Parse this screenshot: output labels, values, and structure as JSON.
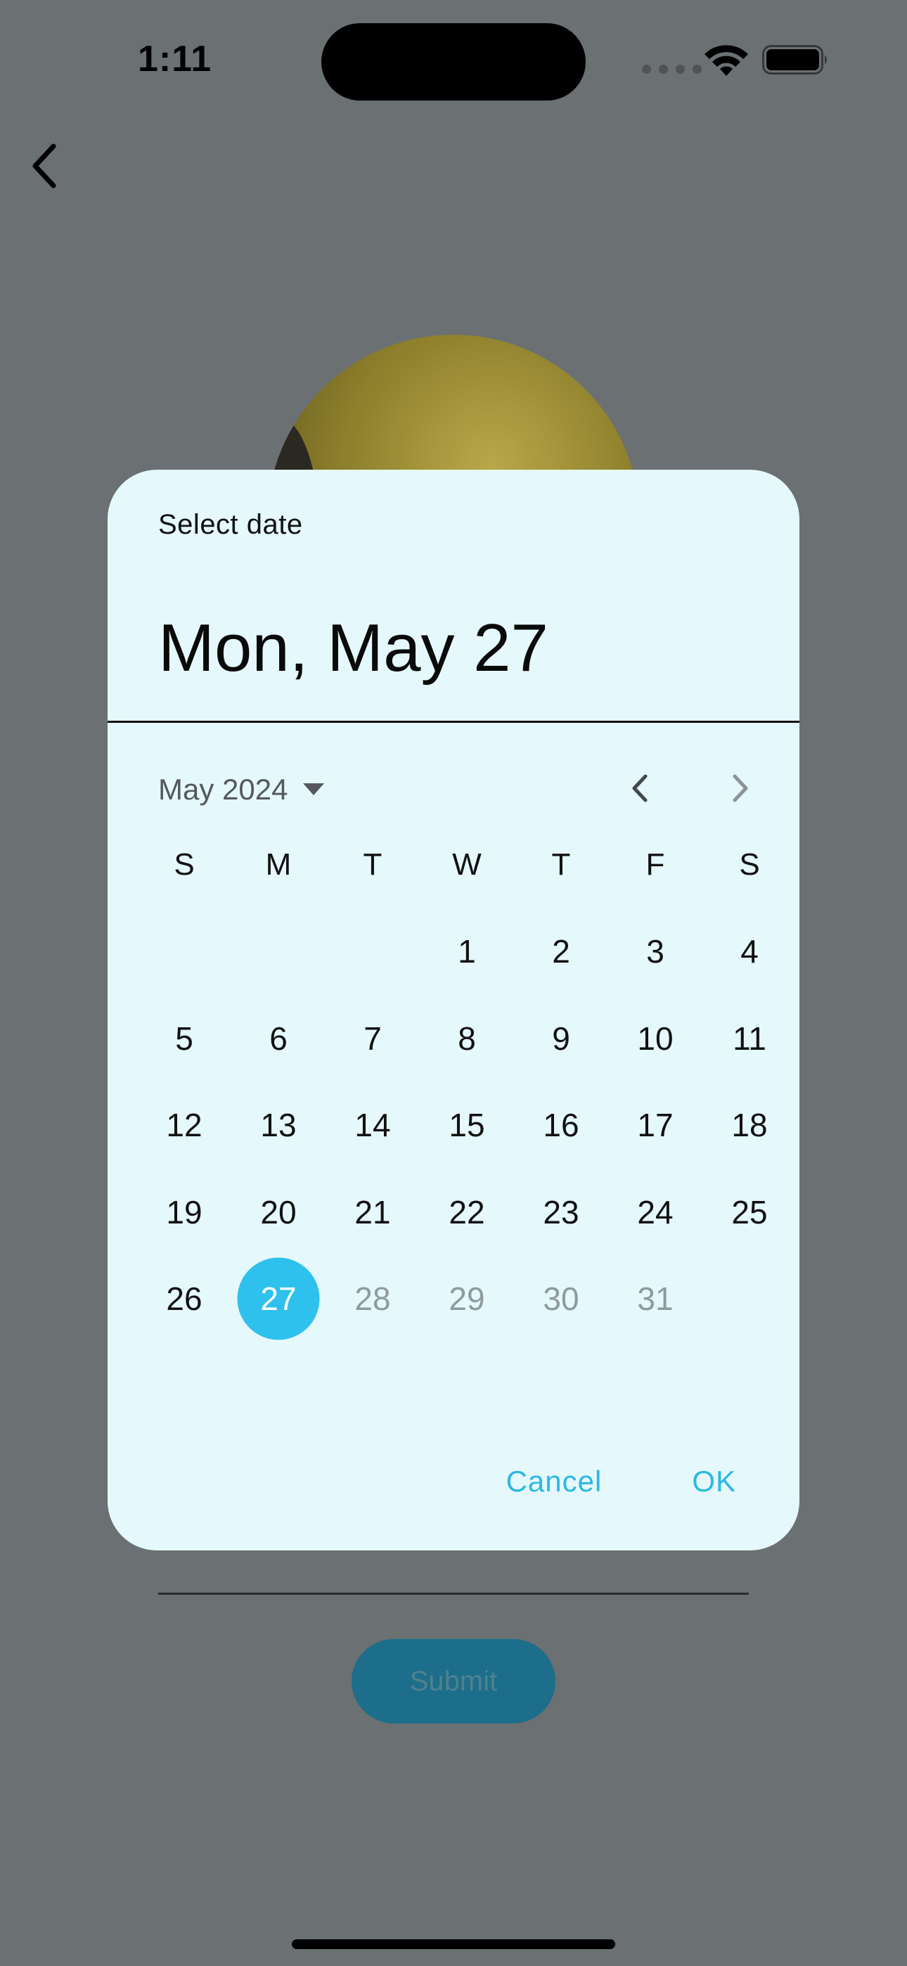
{
  "status_bar": {
    "time": "1:11"
  },
  "background": {
    "submit_label": "Submit"
  },
  "dialog": {
    "label": "Select date",
    "headline": "Mon, May 27",
    "month_label": "May 2024",
    "weekdays": [
      "S",
      "M",
      "T",
      "W",
      "T",
      "F",
      "S"
    ],
    "days": [
      "",
      "",
      "",
      "1",
      "2",
      "3",
      "4",
      "5",
      "6",
      "7",
      "8",
      "9",
      "10",
      "11",
      "12",
      "13",
      "14",
      "15",
      "16",
      "17",
      "18",
      "19",
      "20",
      "21",
      "22",
      "23",
      "24",
      "25",
      "26",
      "27",
      "28",
      "29",
      "30",
      "31",
      ""
    ],
    "selected_day": "27",
    "disabled_days": [
      "28",
      "29",
      "30",
      "31"
    ],
    "cancel_label": "Cancel",
    "ok_label": "OK"
  },
  "colors": {
    "scrim": "#6b7073",
    "dialog_background": "#e5f8fc",
    "accent": "#2ec1ee",
    "submit_button": "#1c6e8a"
  },
  "icons": {
    "back": "chevron-left-icon",
    "prev_month": "chevron-left-icon",
    "next_month": "chevron-right-icon",
    "month_dropdown": "caret-down-icon",
    "wifi": "wifi-icon",
    "battery": "battery-icon"
  }
}
